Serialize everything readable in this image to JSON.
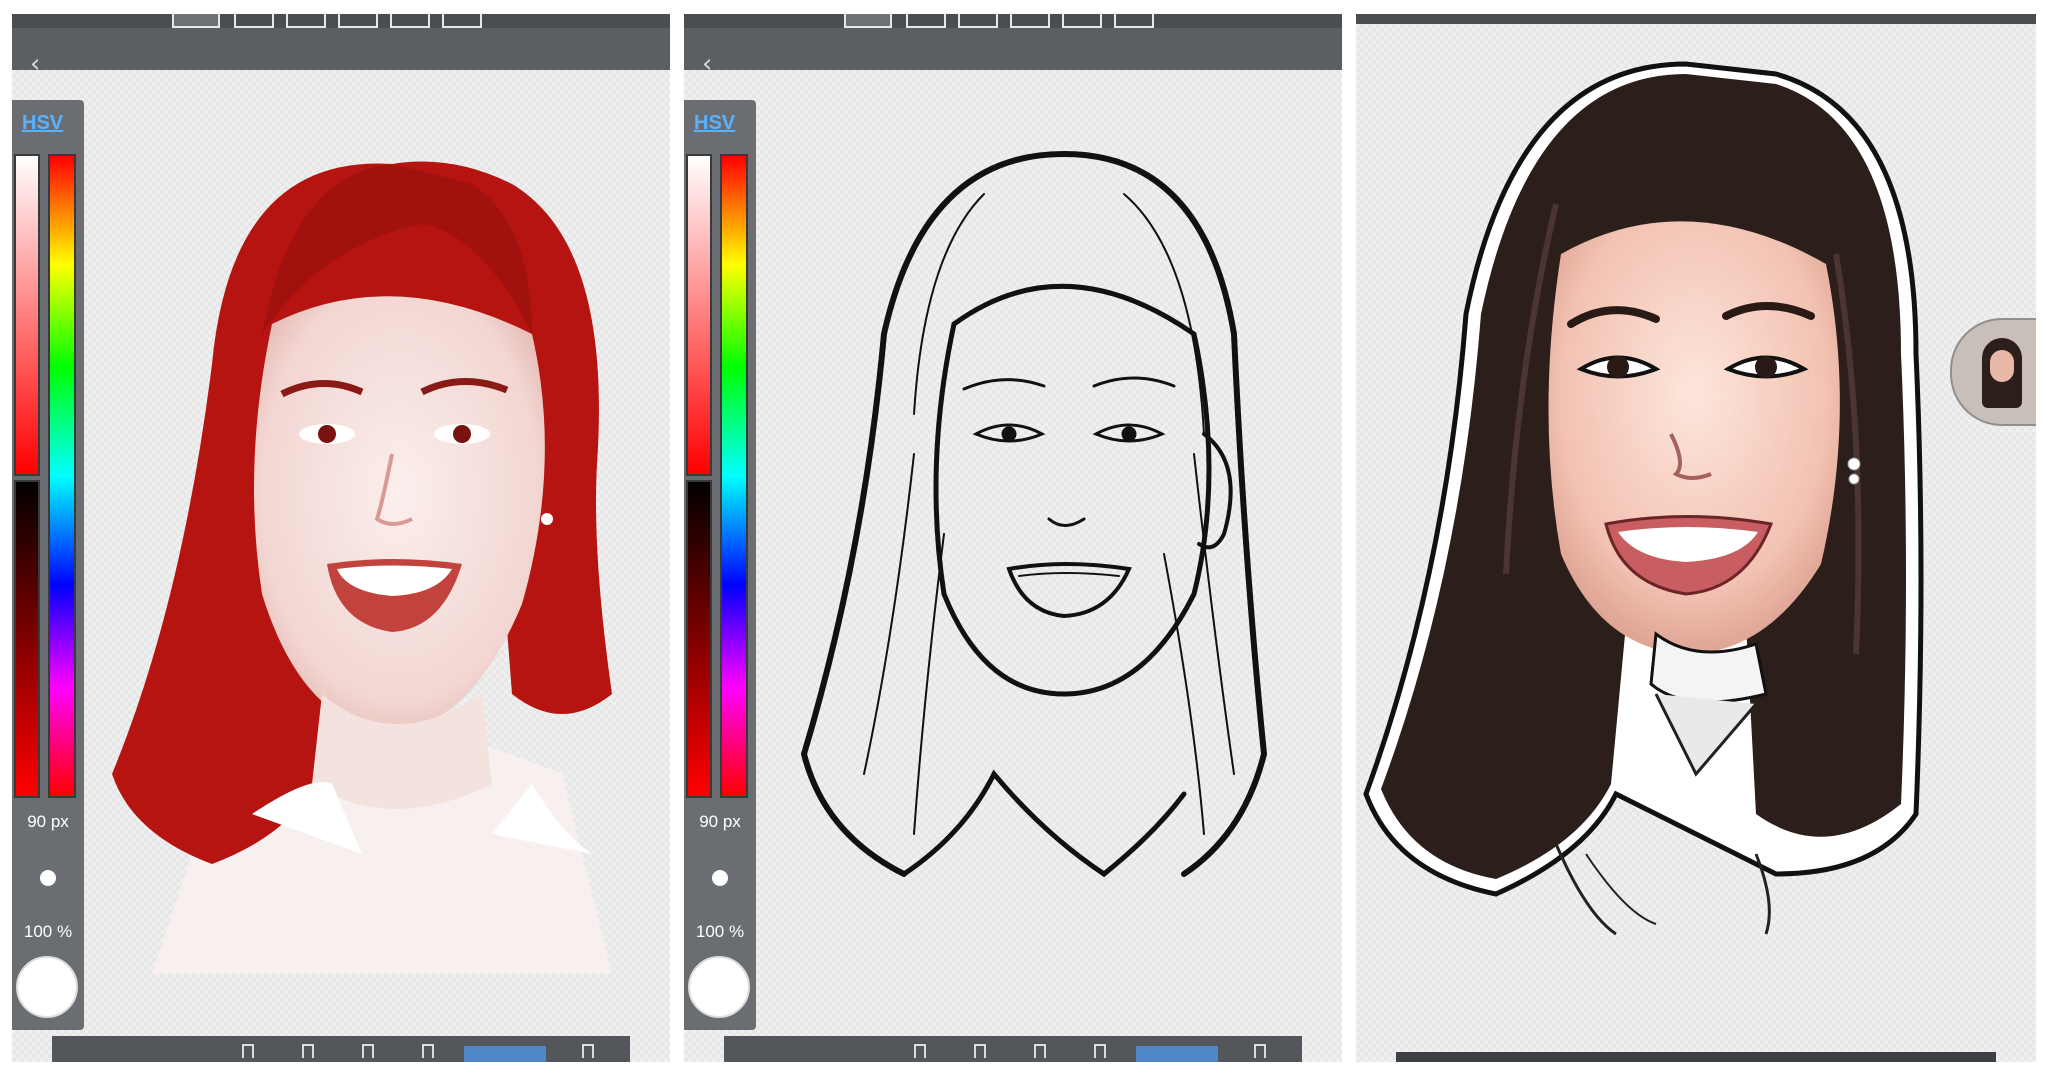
{
  "panels": [
    {
      "name": "reference-photo",
      "palette": {
        "mode_label": "HSV",
        "brush_size": "90 px",
        "opacity": "100 %"
      }
    },
    {
      "name": "line-sketch",
      "palette": {
        "mode_label": "HSV",
        "brush_size": "90 px",
        "opacity": "100 %"
      }
    },
    {
      "name": "colored-painting"
    }
  ],
  "colors": {
    "toolbar": "#5b5f63",
    "palette_bg": "#6a6e72",
    "hsv_accent": "#5ab2ff",
    "tint_red": "#b51410",
    "hair_dark": "#2c1f1b",
    "skin": "#f3c4b5",
    "selection_blue": "#4f86c6"
  },
  "icons": [
    "back-arrow-icon",
    "brush-tool-icon",
    "eraser-tool-icon",
    "layers-icon",
    "hsv-color-picker-icon",
    "brush-size-indicator-icon",
    "current-color-icon",
    "reference-thumbnail-icon"
  ]
}
